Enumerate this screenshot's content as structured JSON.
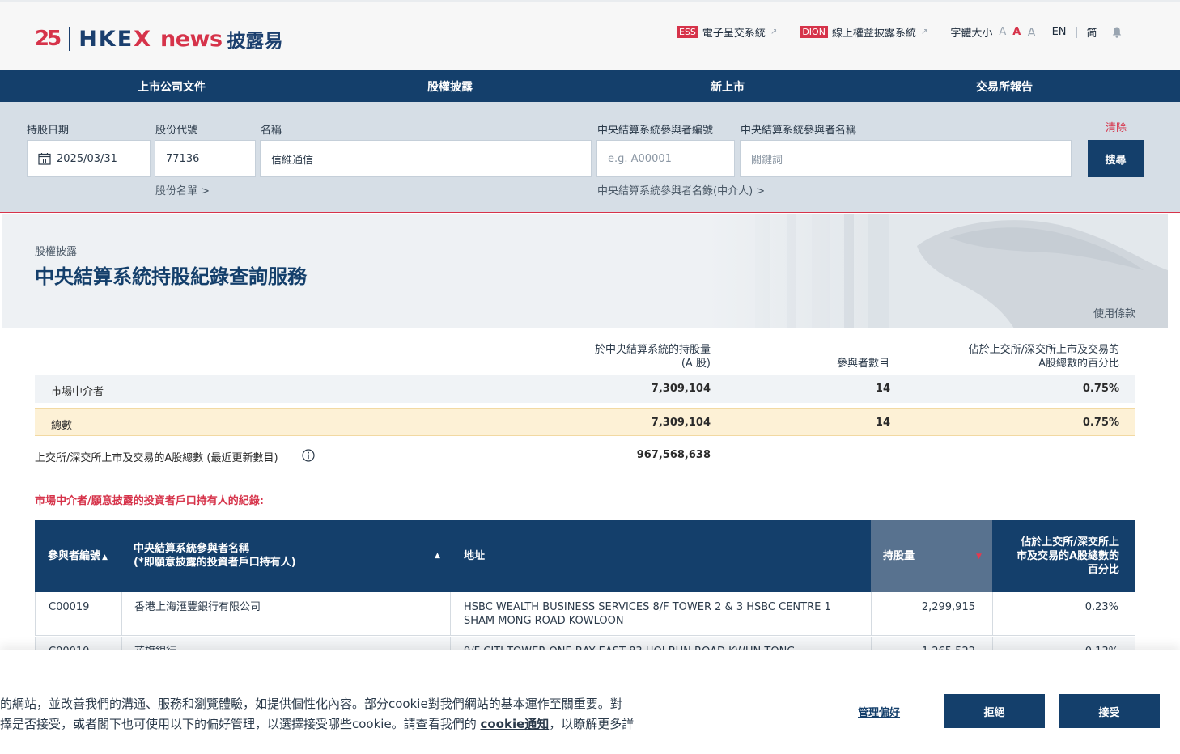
{
  "header": {
    "logo_anniversary": "25",
    "logo_hkex_left": "HKE",
    "logo_hkex_x": "X",
    "logo_news": "news",
    "logo_cn": "披露易",
    "ess_badge": "ESS",
    "ess_label": "電子呈交系統",
    "dion_badge": "DION",
    "dion_label": "線上權益披露系統",
    "font_size_label": "字體大小",
    "font_a": "A",
    "lang_en": "EN",
    "lang_sc": "简"
  },
  "nav": {
    "items": [
      "上市公司文件",
      "股權披露",
      "新上市",
      "交易所報告"
    ]
  },
  "search": {
    "date_label": "持股日期",
    "date_value": "2025/03/31",
    "code_label": "股份代號",
    "code_value": "77136",
    "name_label": "名稱",
    "name_value": "信維通信",
    "pid_label": "中央結算系統參與者編號",
    "pid_placeholder": "e.g. A00001",
    "pname_label": "中央結算系統參與者名稱",
    "pname_placeholder": "關鍵詞",
    "stock_list_link": "股份名單 >",
    "participant_list_link": "中央結算系統參與者名錄(中介人) >",
    "clear": "清除",
    "submit": "搜尋"
  },
  "banner": {
    "breadcrumb": "股權披露",
    "title": "中央結算系統持股紀錄查詢服務",
    "terms": "使用條款"
  },
  "summary": {
    "col_holding_line1": "於中央結算系統的持股量",
    "col_holding_line2": "(A 股)",
    "col_count": "參與者數目",
    "col_pct_line1": "佔於上交所/深交所上市及交易的",
    "col_pct_line2": "A股總數的百分比",
    "intermediary_label": "市場中介者",
    "intermediary_holding": "7,309,104",
    "intermediary_count": "14",
    "intermediary_pct": "0.75%",
    "total_label": "總數",
    "total_holding": "7,309,104",
    "total_count": "14",
    "total_pct": "0.75%",
    "issued_label": "上交所/深交所上市及交易的A股總數 (最近更新數目)",
    "issued_value": "967,568,638"
  },
  "records": {
    "title": "市場中介者/願意披露的投資者戶口持有人的紀錄:",
    "headers": {
      "pid": "參與者編號",
      "name_line1": "中央結算系統參與者名稱",
      "name_line2": "(*即願意披露的投資者戶口持有人)",
      "address": "地址",
      "holding": "持股量",
      "pct_line1": "佔於上交所/深交所上",
      "pct_line2": "市及交易的A股總數的",
      "pct_line3": "百分比"
    },
    "rows": [
      {
        "pid": "C00019",
        "name": "香港上海滙豐銀行有限公司",
        "address_line1": "HSBC WEALTH BUSINESS SERVICES 8/F TOWER 2 & 3 HSBC CENTRE 1",
        "address_line2": "SHAM MONG ROAD KOWLOON",
        "holding": "2,299,915",
        "pct": "0.23%"
      },
      {
        "pid": "C00010",
        "name": "花旗銀行",
        "address_line1": "9/F CITI TOWER ONE BAY EAST 83 HOI BUN ROAD KWUN TONG",
        "address_line2": "",
        "holding": "1,265,522",
        "pct": "0.13%"
      }
    ]
  },
  "cookie": {
    "line1": "的網站，並改善我們的溝通、服務和瀏覽體驗，如提供個性化內容。部分cookie對我們網站的基本運作至關重要。對",
    "line2_pre": "擇是否接受，或者閣下也可使用以下的偏好管理，以選擇接受哪些cookie。請查看我們的 ",
    "line2_link": "cookie通知",
    "line2_post": "，以瞭解更多詳",
    "manage": "管理偏好",
    "reject": "拒絕",
    "accept": "接受"
  },
  "colors": {
    "brand_navy": "#143f6b",
    "brand_red": "#d6334a",
    "highlight_yellow": "#fdf1d6"
  }
}
